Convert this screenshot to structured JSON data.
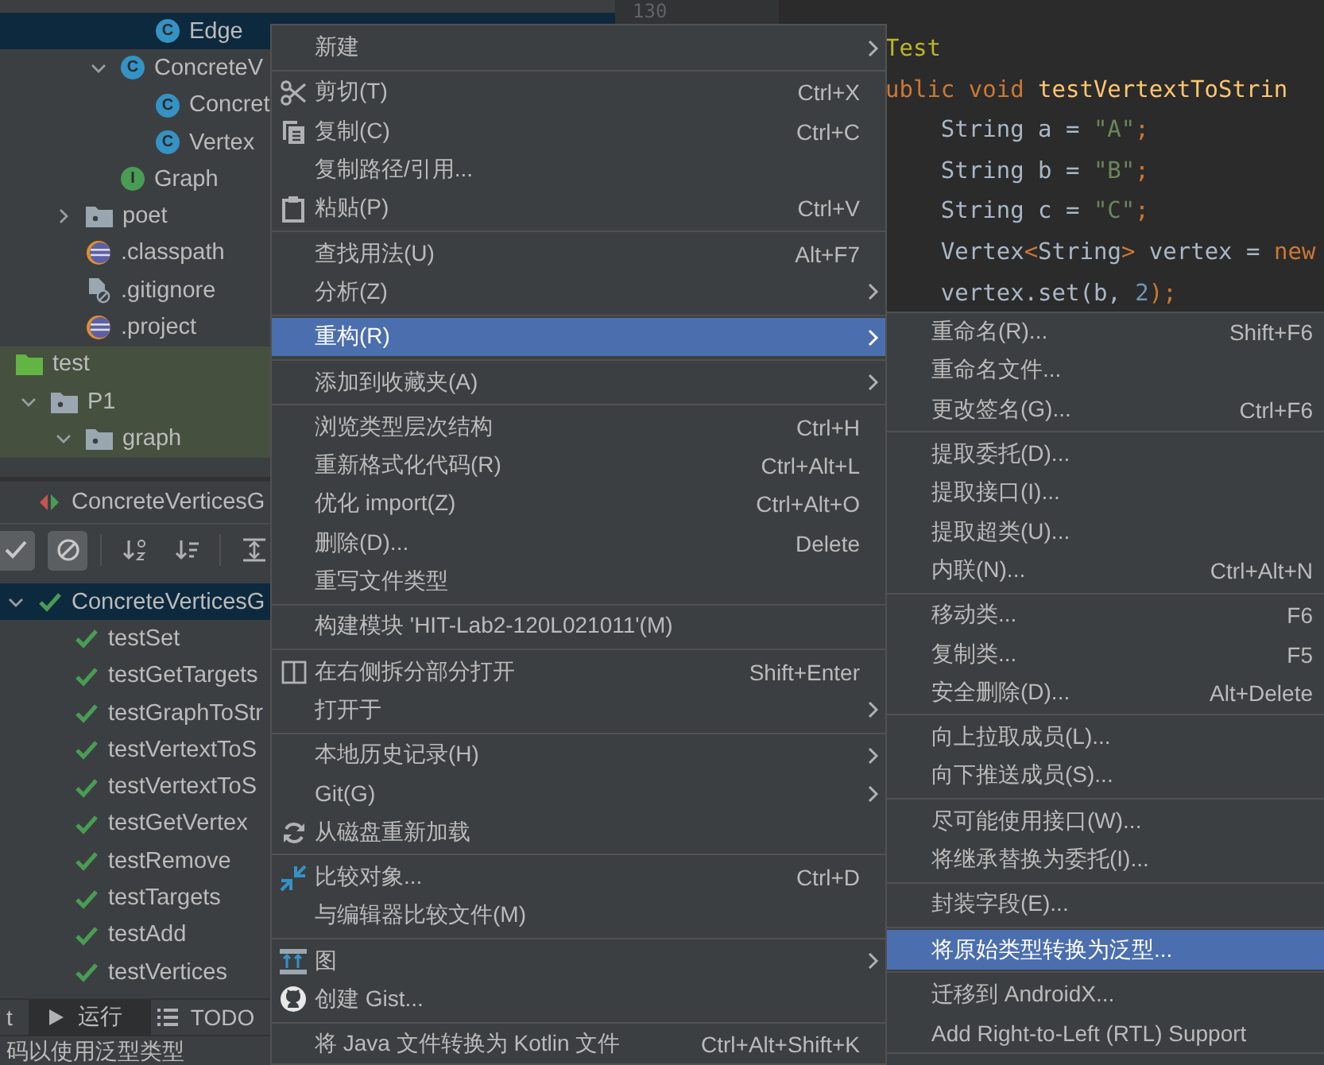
{
  "project_tree": [
    {
      "children": [
        {
          "children": [
            {
              "children": [
                {
                  "children": [
                    {
                      "label": "Edge",
                      "kind": "class",
                      "badge": "C",
                      "selected": true
                    }
                  ]
                },
                {
                  "label": "ConcreteV",
                  "kind": "class",
                  "badge": "C",
                  "expanded": true,
                  "selected": false,
                  "children": [
                    {
                      "label": "Concret",
                      "kind": "class",
                      "badge": "C",
                      "selected": false
                    },
                    {
                      "label": "Vertex",
                      "kind": "class",
                      "badge": "C",
                      "selected": false
                    }
                  ]
                },
                {
                  "label": "Graph",
                  "kind": "interface",
                  "badge": "I",
                  "selected": false
                }
              ]
            },
            {
              "label": "poet",
              "kind": "package",
              "expanded": false,
              "selected": false
            },
            {
              "label": ".classpath",
              "kind": "eclipse",
              "selected": false
            },
            {
              "label": ".gitignore",
              "kind": "ignore",
              "selected": false
            },
            {
              "label": ".project",
              "kind": "eclipse",
              "selected": false
            }
          ]
        }
      ]
    },
    {
      "label": "test",
      "kind": "source-folder",
      "test_sources": true,
      "selected": false,
      "children": [
        {
          "label": "P1",
          "kind": "package",
          "expanded": true,
          "selected": false,
          "children": [
            {
              "label": "graph",
              "kind": "package",
              "expanded": true,
              "selected": false
            }
          ]
        }
      ]
    }
  ],
  "gutter": {
    "line_number": "130"
  },
  "code_lines": [
    [
      {
        "text": "Test",
        "kind": "annotation"
      }
    ],
    [
      {
        "text": "ublic void ",
        "kind": "keyword"
      },
      {
        "text": "testVertextToStrin",
        "kind": "method"
      }
    ],
    [
      {
        "text": "    String a = ",
        "kind": "plain"
      },
      {
        "text": "\"A\"",
        "kind": "string"
      },
      {
        "text": ";",
        "kind": "keyword"
      }
    ],
    [
      {
        "text": "    String b = ",
        "kind": "plain"
      },
      {
        "text": "\"B\"",
        "kind": "string"
      },
      {
        "text": ";",
        "kind": "keyword"
      }
    ],
    [
      {
        "text": "    String c = ",
        "kind": "plain"
      },
      {
        "text": "\"C\"",
        "kind": "string"
      },
      {
        "text": ";",
        "kind": "keyword"
      }
    ],
    [
      {
        "text": "    Vertex",
        "kind": "plain"
      },
      {
        "text": "<",
        "kind": "keyword"
      },
      {
        "text": "String",
        "kind": "plain"
      },
      {
        "text": ">",
        "kind": "keyword"
      },
      {
        "text": " vertex = ",
        "kind": "plain"
      },
      {
        "text": "new",
        "kind": "keyword"
      }
    ],
    [
      {
        "text": "    vertex.set(b, ",
        "kind": "plain"
      },
      {
        "text": "2",
        "kind": "number"
      },
      {
        "text": ");",
        "kind": "keyword"
      }
    ]
  ],
  "run_panel": {
    "tab": {
      "label": "ConcreteVerticesG",
      "kind": "run-config"
    },
    "toolbar": [
      [
        {
          "kind": "check",
          "selected": true
        },
        {
          "kind": "cancel",
          "selected": true
        }
      ],
      [
        {
          "kind": "sort-alpha",
          "selected": false
        },
        {
          "kind": "sort-duration",
          "selected": false
        }
      ],
      [
        {
          "kind": "expand",
          "selected": false
        }
      ]
    ],
    "tests": [
      {
        "label": "ConcreteVerticesG",
        "kind": "passed",
        "expanded": true,
        "selected": true,
        "children": [
          {
            "label": "testSet",
            "kind": "passed",
            "selected": false
          },
          {
            "label": "testGetTargets",
            "kind": "passed",
            "selected": false
          },
          {
            "label": "testGraphToStr",
            "kind": "passed",
            "selected": false
          },
          {
            "label": "testVertextToS",
            "kind": "passed",
            "selected": false
          },
          {
            "label": "testVertextToS",
            "kind": "passed",
            "selected": false
          },
          {
            "label": "testGetVertex",
            "kind": "passed",
            "selected": false
          },
          {
            "label": "testRemove",
            "kind": "passed",
            "selected": false
          },
          {
            "label": "testTargets",
            "kind": "passed",
            "selected": false
          },
          {
            "label": "testAdd",
            "kind": "passed",
            "selected": false
          },
          {
            "label": "testVertices",
            "kind": "passed",
            "selected": false
          }
        ]
      }
    ]
  },
  "bottom_tabs": [
    {
      "label": "t",
      "selected": false
    },
    {
      "label": "运行",
      "kind": "play",
      "selected": true
    },
    {
      "label": "TODO",
      "kind": "list",
      "selected": false
    }
  ],
  "status_bar": {
    "text": "码以使用泛型类型"
  },
  "context_menu": [
    [
      {
        "label": "新建",
        "submenu": true,
        "selected": false
      }
    ],
    [
      {
        "label": "剪切(T)",
        "shortcut": "Ctrl+X",
        "kind": "scissors",
        "selected": false
      },
      {
        "label": "复制(C)",
        "shortcut": "Ctrl+C",
        "kind": "copy",
        "selected": false
      },
      {
        "label": "复制路径/引用...",
        "selected": false
      },
      {
        "label": "粘贴(P)",
        "shortcut": "Ctrl+V",
        "kind": "clipboard",
        "selected": false
      }
    ],
    [
      {
        "label": "查找用法(U)",
        "shortcut": "Alt+F7",
        "selected": false
      },
      {
        "label": "分析(Z)",
        "submenu": true,
        "selected": false
      }
    ],
    [
      {
        "label": "重构(R)",
        "submenu": true,
        "selected": true
      }
    ],
    [
      {
        "label": "添加到收藏夹(A)",
        "submenu": true,
        "selected": false
      }
    ],
    [
      {
        "label": "浏览类型层次结构",
        "shortcut": "Ctrl+H",
        "selected": false
      },
      {
        "label": "重新格式化代码(R)",
        "shortcut": "Ctrl+Alt+L",
        "selected": false
      },
      {
        "label": "优化 import(Z)",
        "shortcut": "Ctrl+Alt+O",
        "selected": false
      },
      {
        "label": "删除(D)...",
        "shortcut": "Delete",
        "selected": false
      },
      {
        "label": "重写文件类型",
        "selected": false
      }
    ],
    [
      {
        "label": "构建模块 'HIT-Lab2-120L021011'(M)",
        "selected": false
      }
    ],
    [
      {
        "label": "在右侧拆分部分打开",
        "shortcut": "Shift+Enter",
        "kind": "split",
        "selected": false
      },
      {
        "label": "打开于",
        "submenu": true,
        "selected": false
      }
    ],
    [
      {
        "label": "本地历史记录(H)",
        "submenu": true,
        "selected": false
      },
      {
        "label": "Git(G)",
        "submenu": true,
        "selected": false
      },
      {
        "label": "从磁盘重新加载",
        "kind": "reload",
        "selected": false
      }
    ],
    [
      {
        "label": "比较对象...",
        "shortcut": "Ctrl+D",
        "kind": "compare",
        "selected": false
      },
      {
        "label": "与编辑器比较文件(M)",
        "selected": false
      }
    ],
    [
      {
        "label": "图",
        "submenu": true,
        "kind": "diagram",
        "selected": false
      },
      {
        "label": "创建 Gist...",
        "kind": "cat",
        "selected": false
      }
    ],
    [
      {
        "label": "将 Java 文件转换为 Kotlin 文件",
        "shortcut": "Ctrl+Alt+Shift+K",
        "selected": false
      }
    ]
  ],
  "refactor_submenu": [
    [
      {
        "label": "重命名(R)...",
        "shortcut": "Shift+F6",
        "selected": false
      },
      {
        "label": "重命名文件...",
        "selected": false
      },
      {
        "label": "更改签名(G)...",
        "shortcut": "Ctrl+F6",
        "selected": false
      }
    ],
    [
      {
        "label": "提取委托(D)...",
        "selected": false
      },
      {
        "label": "提取接口(I)...",
        "selected": false
      },
      {
        "label": "提取超类(U)...",
        "selected": false
      },
      {
        "label": "内联(N)...",
        "shortcut": "Ctrl+Alt+N",
        "selected": false
      }
    ],
    [
      {
        "label": "移动类...",
        "shortcut": "F6",
        "selected": false
      },
      {
        "label": "复制类...",
        "shortcut": "F5",
        "selected": false
      },
      {
        "label": "安全删除(D)...",
        "shortcut": "Alt+Delete",
        "selected": false
      }
    ],
    [
      {
        "label": "向上拉取成员(L)...",
        "selected": false
      },
      {
        "label": "向下推送成员(S)...",
        "selected": false
      }
    ],
    [
      {
        "label": "尽可能使用接口(W)...",
        "selected": false
      },
      {
        "label": "将继承替换为委托(I)...",
        "selected": false
      }
    ],
    [
      {
        "label": "封装字段(E)...",
        "selected": false
      }
    ],
    [
      {
        "label": "将原始类型转换为泛型...",
        "selected": true
      }
    ],
    [
      {
        "label": "迁移到 AndroidX...",
        "selected": false
      },
      {
        "label": "Add Right-to-Left (RTL) Support",
        "selected": false
      }
    ]
  ]
}
